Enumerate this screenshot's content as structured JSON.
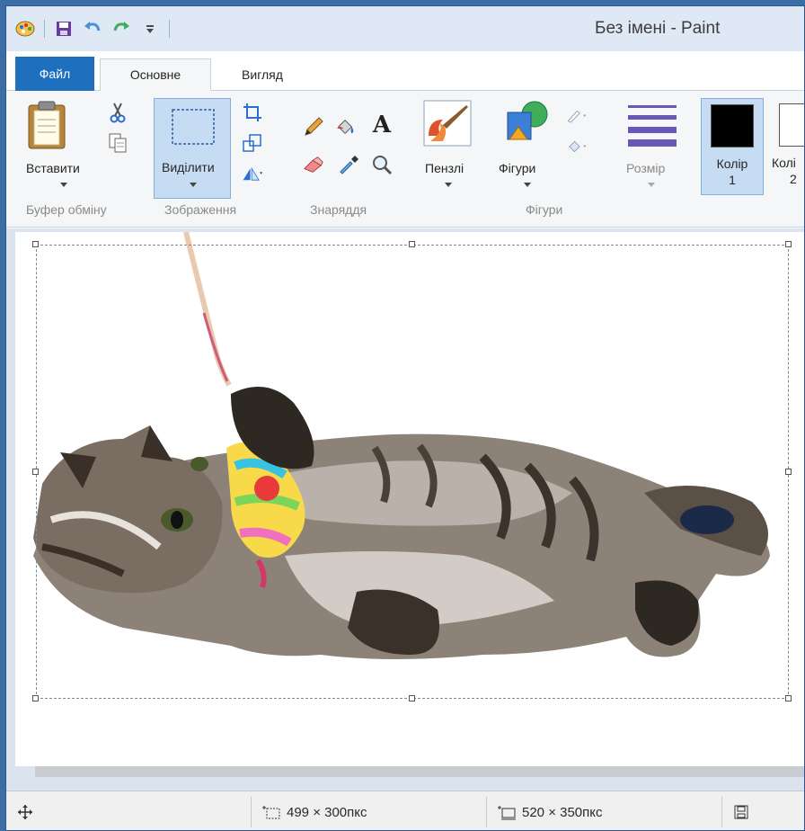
{
  "window": {
    "title": "Без імені - Paint"
  },
  "quick_access": {
    "icons": [
      "paint-app-icon",
      "save-icon",
      "undo-icon",
      "redo-icon",
      "customize-icon"
    ]
  },
  "tabs": {
    "file": "Файл",
    "home": "Основне",
    "view": "Вигляд"
  },
  "ribbon": {
    "paste_label": "Вставити",
    "select_label": "Виділити",
    "brushes_label": "Пензлі",
    "shapes_label": "Фігури",
    "size_label": "Розмір",
    "color1_label": "Колір",
    "color1_num": "1",
    "color2_label": "Колі",
    "color2_num": "2",
    "groups": {
      "clipboard": "Буфер обміну",
      "image": "Зображення",
      "tools": "Знаряддя",
      "shapes": "Фігури"
    },
    "colors": {
      "color1": "#000000",
      "color2": "#ffffff"
    }
  },
  "status": {
    "selection_size": "499 × 300пкс",
    "canvas_size": "520 × 350пкс"
  },
  "colors": {
    "accent": "#1e6fbe",
    "selection_highlight": "#c5dcf3",
    "desktop": "#3b6ea5"
  }
}
